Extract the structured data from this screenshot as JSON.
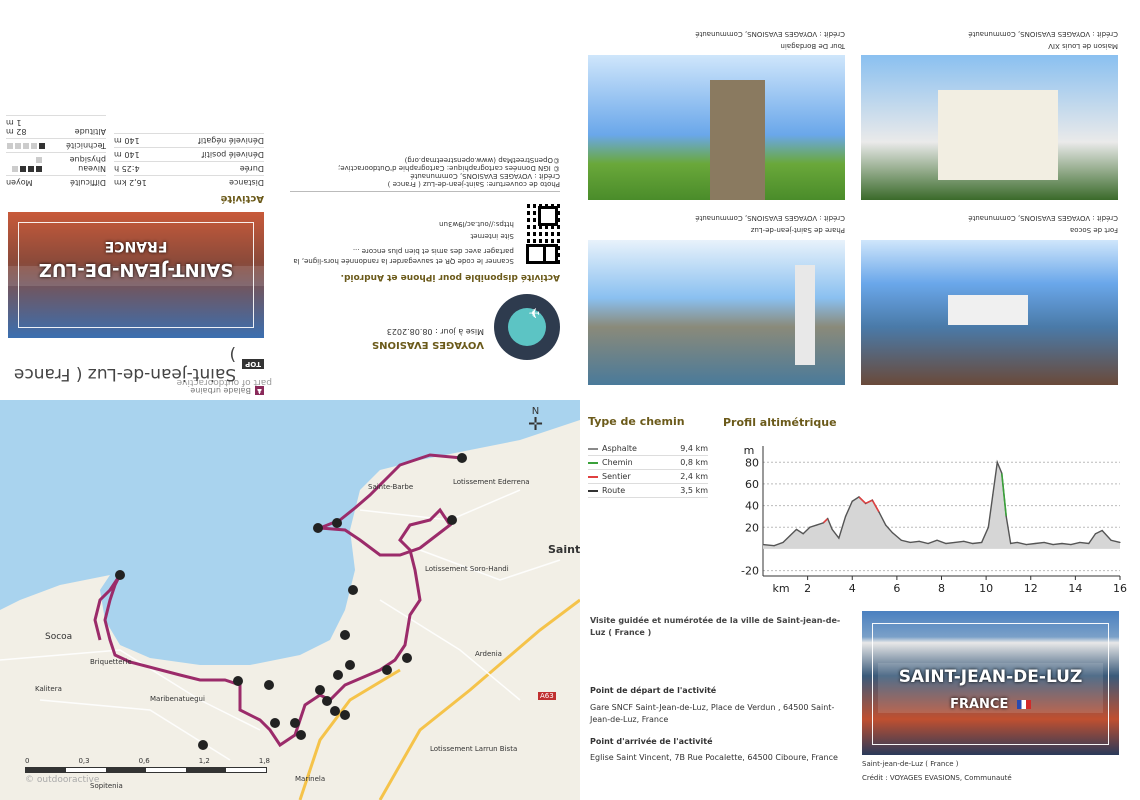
{
  "top_left": {
    "outdoor_brand": "part of outdooractive",
    "category": "Balade urbaine",
    "top_badge": "TOP",
    "title": "Saint-jean-de-Luz ( France )",
    "cover_text_1": "SAINT-JEAN-DE-LUZ",
    "cover_text_2": "FRANCE",
    "section": "Activité",
    "stats": [
      {
        "label": "Distance",
        "value": "16,2",
        "unit": "km"
      },
      {
        "label": "Durée",
        "value": "4:25",
        "unit": "h"
      },
      {
        "label": "Dénivelé positif",
        "value": "140",
        "unit": "m"
      },
      {
        "label": "Dénivelé négatif",
        "value": "140",
        "unit": "m"
      }
    ],
    "ratings": [
      {
        "label": "Difficulté",
        "value": "Moyen"
      },
      {
        "label": "Niveau physique",
        "value": 3
      },
      {
        "label": "Technicité",
        "value": 1
      },
      {
        "label": "Altitude",
        "value": ""
      }
    ],
    "alt_max": "82 m",
    "alt_min": "1 m",
    "author": "VOYAGES EVASIONS",
    "updated": "Mise à jour : 08.08.2023",
    "app_heading": "Activité disponible pour iPhone et Android.",
    "app_text": "Scanner le code QR et sauvegarder la randonnée hors-ligne, la partager avec des amis et bien plus encore ...",
    "site_label": "Site internet",
    "site_url": "https://out.ac/l9w3un",
    "credit_cover": "Photo de couverture: Saint-jean-de-Luz ( France )",
    "credit_cover_2": "Crédit : VOYAGES EVASIONS, Communauté",
    "credit_ign": "© IGN Données cartographique: Cartographie d'Outdooractive;",
    "credit_osm": "©OpenStreetMap (www.openstreetmap.org)"
  },
  "top_right": {
    "photos": [
      {
        "caption": "Tour De Bordagain",
        "credit": "Crédit : VOYAGES EVASIONS, Communauté"
      },
      {
        "caption": "Maison de Louis XIV",
        "credit": "Crédit : VOYAGES EVASIONS, Communauté"
      },
      {
        "caption": "Phare de Saint-jean-de-Luz",
        "credit": "Crédit : VOYAGES EVASIONS, Communauté"
      },
      {
        "caption": "Fort de Socoa",
        "credit": "Crédit : VOYAGES EVASIONS, Communauté"
      }
    ]
  },
  "map": {
    "place_labels": [
      "Sainte-Barbe",
      "Lotissement Ederrena",
      "Lotissement Soro-Handi",
      "Socoa",
      "Briquetterie",
      "Kalitera",
      "Maribenatuegui",
      "Ardenia",
      "Lotissement Larrun Bista",
      "Marinela",
      "Sopitenia",
      "Saint",
      "A63"
    ],
    "north": "N",
    "scale": [
      "0",
      "0,3",
      "0,6",
      "1,2",
      "1,8"
    ],
    "watermark": "© outdooractive"
  },
  "surface": {
    "title": "Type de chemin",
    "items": [
      {
        "name": "Asphalte",
        "value": "9,4 km",
        "color": "#8a8a8a"
      },
      {
        "name": "Chemin",
        "value": "0,8 km",
        "color": "#3aa13a"
      },
      {
        "name": "Sentier",
        "value": "2,4 km",
        "color": "#e04040"
      },
      {
        "name": "Route",
        "value": "3,5 km",
        "color": "#333333"
      }
    ]
  },
  "chart_data": {
    "type": "area",
    "title": "Profil altimétrique",
    "xlabel": "km",
    "ylabel": "m",
    "xlim": [
      0,
      16
    ],
    "ylim": [
      -25,
      95
    ],
    "xticks": [
      2,
      4,
      6,
      8,
      10,
      12,
      14,
      16
    ],
    "yticks": [
      -20,
      20,
      40,
      60,
      80
    ],
    "x": [
      0,
      0.5,
      0.9,
      1.2,
      1.5,
      1.8,
      2.1,
      2.4,
      2.7,
      2.9,
      3.1,
      3.4,
      3.7,
      4.0,
      4.3,
      4.6,
      4.9,
      5.2,
      5.5,
      5.8,
      6.2,
      6.6,
      7.0,
      7.4,
      7.8,
      8.2,
      8.6,
      9.0,
      9.4,
      9.8,
      10.1,
      10.3,
      10.5,
      10.7,
      10.9,
      11.1,
      11.4,
      11.8,
      12.2,
      12.6,
      13.0,
      13.4,
      13.8,
      14.2,
      14.6,
      14.9,
      15.2,
      15.6,
      16.0
    ],
    "y": [
      4,
      3,
      6,
      12,
      18,
      14,
      20,
      22,
      24,
      28,
      18,
      10,
      30,
      44,
      48,
      42,
      45,
      34,
      22,
      15,
      8,
      6,
      7,
      5,
      8,
      5,
      6,
      7,
      5,
      6,
      20,
      50,
      80,
      70,
      30,
      5,
      6,
      4,
      5,
      6,
      4,
      5,
      4,
      6,
      5,
      14,
      17,
      8,
      6
    ],
    "grid": true
  },
  "bottom_right": {
    "description": "Visite guidée et numérotée de la ville de Saint-jean-de-Luz ( France )",
    "start_heading": "Point de départ de l'activité",
    "start_text": "Gare SNCF Saint-Jean-de-Luz, Place de Verdun , 64500 Saint-Jean-de-Luz, France",
    "end_heading": "Point d'arrivée de l'activité",
    "end_text": "Eglise Saint Vincent, 7B Rue Pocalette, 64500 Ciboure, France",
    "cover_text_1": "SAINT-JEAN-DE-LUZ",
    "cover_text_2": "FRANCE",
    "photo_caption": "Saint-jean-de-Luz ( France )",
    "photo_credit": "Crédit : VOYAGES EVASIONS, Communauté"
  },
  "colors": {
    "route": "#9b2b6a",
    "olive": "#6b5a1a",
    "sea": "#a9d3ee",
    "land": "#f2efe6"
  }
}
